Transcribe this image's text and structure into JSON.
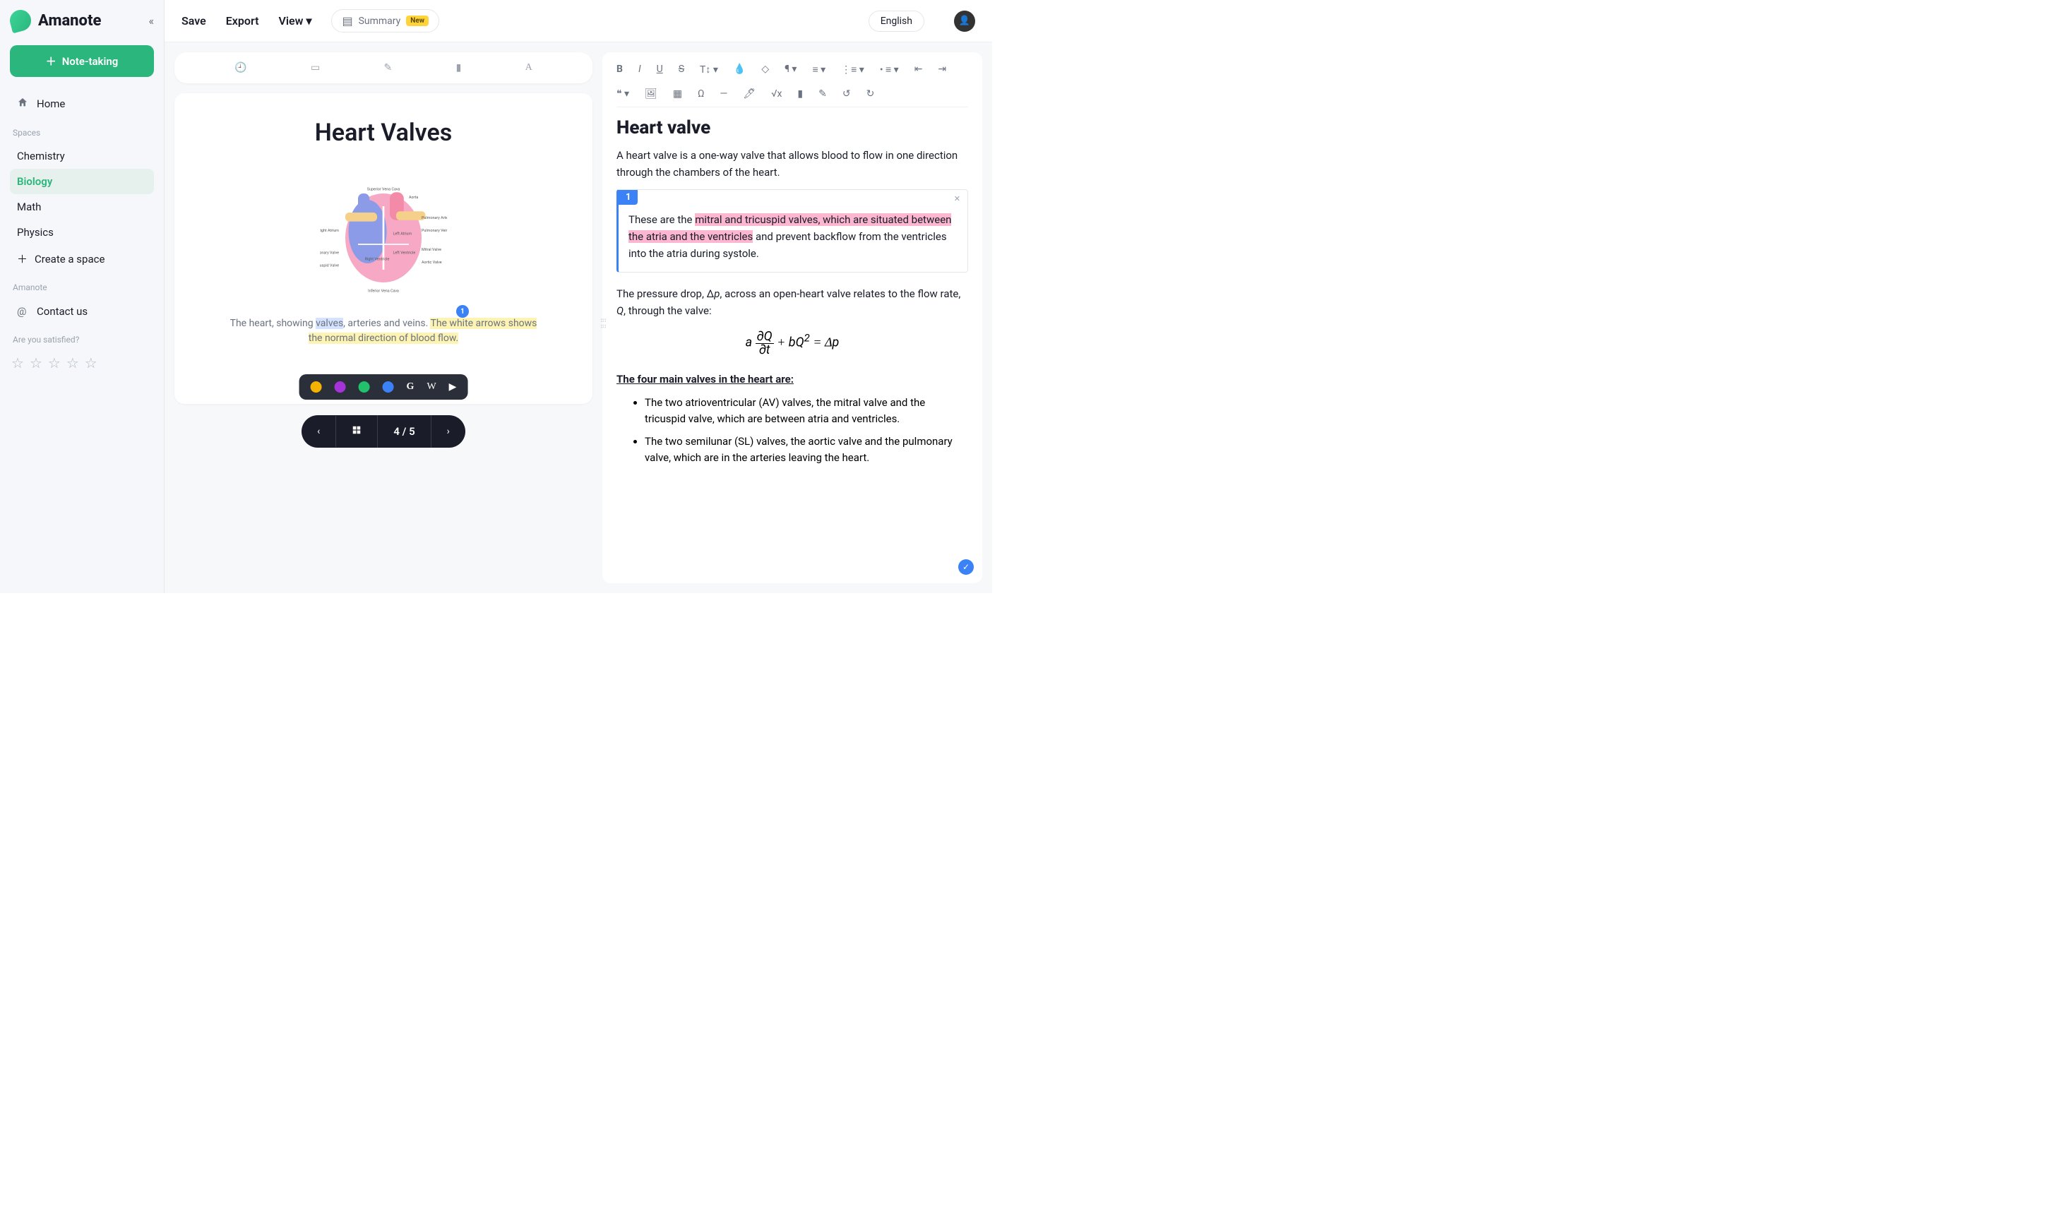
{
  "app": {
    "name": "Amanote"
  },
  "sidebar": {
    "new_note": "Note-taking",
    "home": "Home",
    "spaces_label": "Spaces",
    "spaces": [
      {
        "label": "Chemistry",
        "active": false
      },
      {
        "label": "Biology",
        "active": true
      },
      {
        "label": "Math",
        "active": false
      },
      {
        "label": "Physics",
        "active": false
      }
    ],
    "create_space": "Create a space",
    "amanote_label": "Amanote",
    "contact": "Contact us",
    "satisfied": "Are you satisfied?"
  },
  "topbar": {
    "save": "Save",
    "export": "Export",
    "view": "View",
    "summary": "Summary",
    "summary_badge": "New",
    "language": "English"
  },
  "slide": {
    "title": "Heart Valves",
    "marker": "1",
    "caption_pre": "The heart, showing ",
    "caption_sel": "valves",
    "caption_mid": ", arteries and veins. ",
    "caption_hl": "The white arrows shows the normal direction of blood flow.",
    "page": "4 / 5"
  },
  "popup": {
    "colors": [
      "#f5b301",
      "#a633d9",
      "#21c26b",
      "#3b82f6"
    ]
  },
  "editor": {
    "title": "Heart valve",
    "intro": "A heart valve is a one-way valve that allows blood to flow in one direction through the chambers of the heart.",
    "callout_num": "1",
    "callout_pre": "These are the ",
    "callout_pk": "mitral and tricuspid valves, which are situated between the atria and the ventricles",
    "callout_post": " and prevent backflow from the ventricles into the atria during systole.",
    "pressure_pre": "The pressure drop, Δp, across an open-heart valve relates to the flow rate, Q, through the valve:",
    "equation": "a ∂Q/∂t + bQ² = Δp",
    "list_heading": "The four main valves in the heart are:",
    "items": [
      "The two atrioventricular (AV) valves, the mitral valve and the tricuspid valve, which are between atria and ventricles.",
      "The two semilunar (SL) valves, the aortic valve and the pulmonary valve, which are in the arteries leaving the heart."
    ]
  }
}
